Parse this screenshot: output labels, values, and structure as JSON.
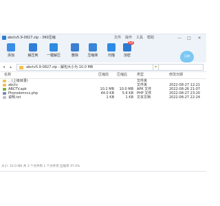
{
  "window": {
    "title": "abctv5.9-0827.zip - 360压缩",
    "menu": [
      "文件",
      "操作",
      "工具",
      "帮助"
    ],
    "controls": [
      "—",
      "□",
      "✕"
    ]
  },
  "toolbar": {
    "buttons": [
      {
        "label": "添加",
        "icon": "add-icon",
        "color": "#3a8ee6"
      },
      {
        "label": "解压到",
        "icon": "extract-icon",
        "color": "#2f7fd8"
      },
      {
        "label": "一键解压",
        "icon": "one-click-extract-icon",
        "color": "#2d8be0"
      },
      {
        "label": "删除",
        "icon": "delete-icon",
        "color": "#3b7fd3"
      },
      {
        "label": "压缩率",
        "icon": "compression-ratio-icon",
        "color": "#3a86d6"
      },
      {
        "label": "扫描",
        "icon": "scan-icon",
        "color": "#2b8be6"
      },
      {
        "label": "加密",
        "icon": "encrypt-icon",
        "color": "#2c7ad2"
      }
    ],
    "badge": "免费",
    "mascot_text": "压缩"
  },
  "address": {
    "path": "abctv5.9-0827.zip - 解包大小为 10.0 MB"
  },
  "columns": [
    "名称",
    "压缩前",
    "压缩后",
    "类型",
    "修改日期"
  ],
  "files": [
    {
      "name": ".. (上级目录)",
      "size": "",
      "packed": "",
      "type": "文件夹",
      "date": "",
      "icon_color": "#f0c24e"
    },
    {
      "name": "abctv",
      "size": "",
      "packed": "",
      "type": "文件夹",
      "date": "2022-08-27 12:21",
      "icon_color": "#f0c24e"
    },
    {
      "name": "ABCTV.apk",
      "size": "10.2 MB",
      "packed": "10.0 MB",
      "type": "APK 文件",
      "date": "2022-08-26 21:07",
      "icon_color": "#76b13d"
    },
    {
      "name": "Phonebmncs.php",
      "size": "44.0 KB",
      "packed": "5.6 KB",
      "type": "PHP 文件",
      "date": "2022-08-27 23:20",
      "icon_color": "#7d86b8"
    },
    {
      "name": "说明.txt",
      "size": "1 KB",
      "packed": "1 KB",
      "type": "文本文档",
      "date": "2022-08-27 22:24",
      "icon_color": "#b9c2cc"
    }
  ],
  "status": "大小: 10.0 MB 共 3 个文件和 1 个文件夹 压缩率 97.0%"
}
